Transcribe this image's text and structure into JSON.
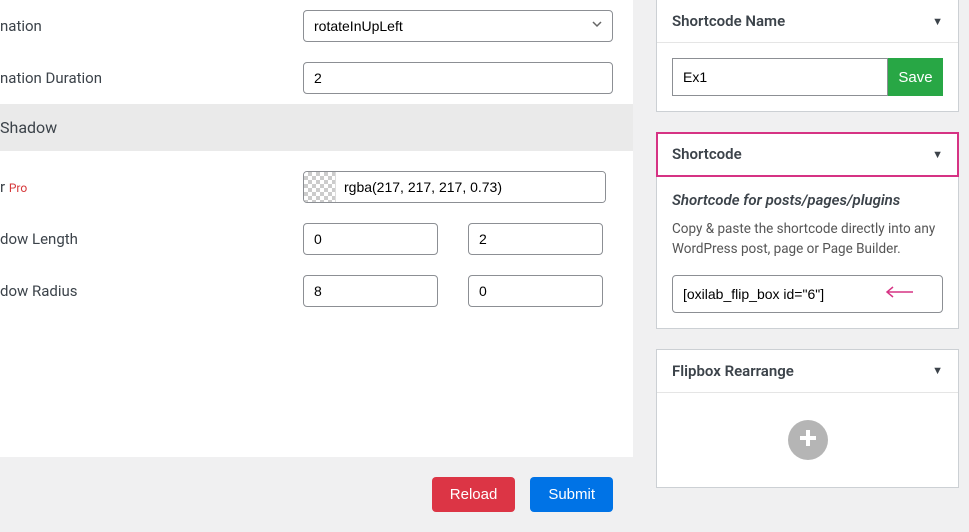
{
  "main": {
    "animation": {
      "label": "nation",
      "selected": "rotateInUpLeft"
    },
    "duration": {
      "label": "nation Duration",
      "value": "2"
    },
    "shadow_section": "Shadow",
    "shadow_color": {
      "label": "r",
      "pro": "Pro",
      "value": "rgba(217, 217, 217, 0.73)"
    },
    "shadow_length": {
      "label": "dow Length",
      "v1": "0",
      "v2": "2"
    },
    "shadow_radius": {
      "label": "dow Radius",
      "v1": "8",
      "v2": "0"
    },
    "buttons": {
      "reload": "Reload",
      "submit": "Submit"
    }
  },
  "sidebar": {
    "shortcode_name": {
      "header": "Shortcode Name",
      "value": "Ex1",
      "save": "Save"
    },
    "shortcode": {
      "header": "Shortcode",
      "sub_label": "Shortcode for posts/pages/plugins",
      "desc": "Copy & paste the shortcode directly into any WordPress post, page or Page Builder.",
      "value": "[oxilab_flip_box id=\"6\"]"
    },
    "rearrange": {
      "header": "Flipbox Rearrange"
    }
  }
}
